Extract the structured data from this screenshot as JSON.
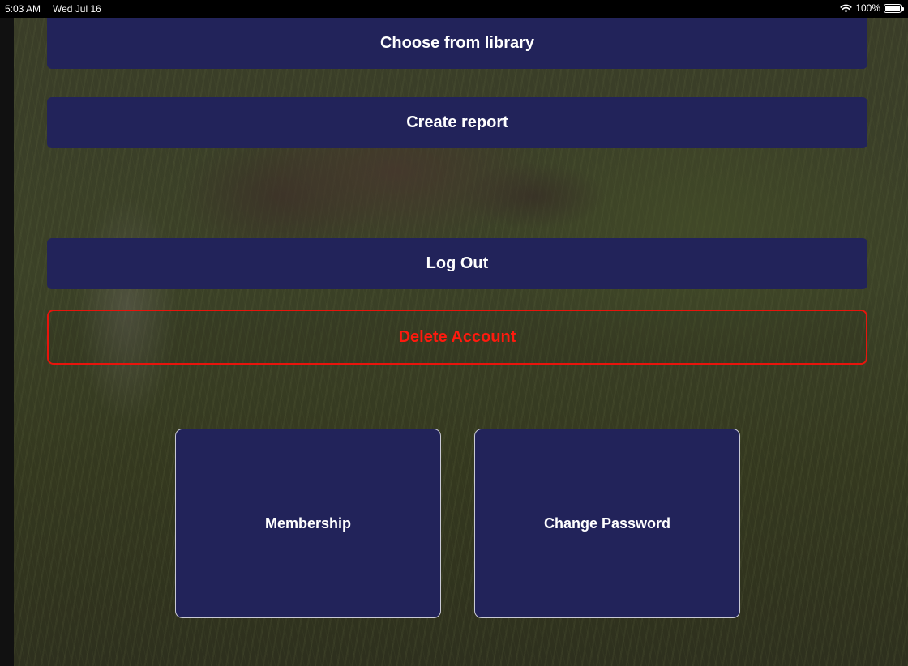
{
  "status_bar": {
    "time": "5:03 AM",
    "date": "Wed Jul 16",
    "battery_text": "100%",
    "battery_level": 1.0,
    "wifi_icon": "wifi-icon",
    "battery_icon": "battery-icon"
  },
  "actions": {
    "choose_library_label": "Choose from library",
    "create_report_label": "Create report",
    "log_out_label": "Log Out",
    "delete_account_label": "Delete Account"
  },
  "account_tiles": {
    "membership_label": "Membership",
    "change_password_label": "Change Password"
  },
  "colors": {
    "button_bg": "#22235a",
    "danger": "#ff1a0e",
    "text": "#ffffff"
  }
}
